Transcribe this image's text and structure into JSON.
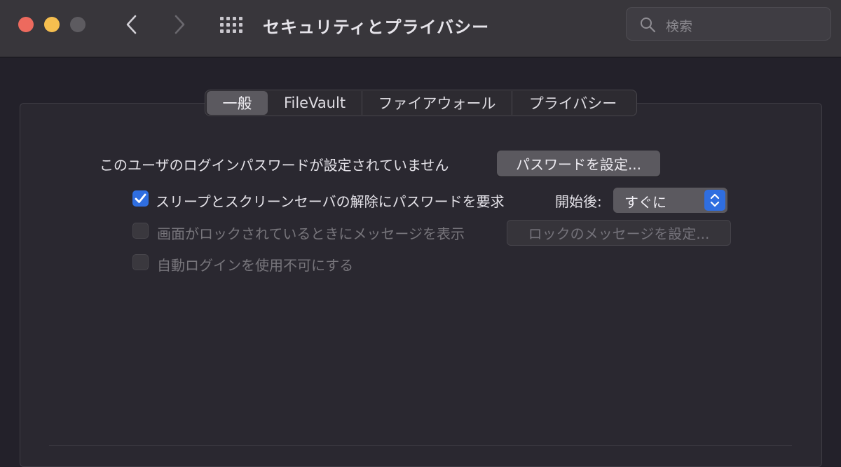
{
  "window": {
    "title": "セキュリティとプライバシー",
    "search_placeholder": "検索"
  },
  "icons": {
    "back": "chevron-left-icon",
    "forward": "chevron-right-icon",
    "grid": "grid-icon",
    "search": "search-icon",
    "check": "checkmark-icon",
    "stepper": "up-down-chevron-icon"
  },
  "tabs": [
    {
      "label": "一般",
      "selected": true
    },
    {
      "label": "FileVault",
      "selected": false
    },
    {
      "label": "ファイアウォール",
      "selected": false
    },
    {
      "label": "プライバシー",
      "selected": false
    }
  ],
  "general": {
    "password_notice": "このユーザのログインパスワードが設定されていません",
    "set_password_button": "パスワードを設定...",
    "require_password": {
      "label": "スリープとスクリーンセーバの解除にパスワードを要求",
      "checked": true,
      "after_label": "開始後:",
      "after_value": "すぐに"
    },
    "show_message": {
      "label": "画面がロックされているときにメッセージを表示",
      "checked": false,
      "enabled": false,
      "button": "ロックのメッセージを設定..."
    },
    "disable_auto_login": {
      "label": "自動ログインを使用不可にする",
      "checked": false,
      "enabled": false
    }
  },
  "colors": {
    "accent": "#2f6ee0",
    "close": "#ed6a5e",
    "minimize": "#f5be4f",
    "zoom_inactive": "#5d5b60"
  }
}
